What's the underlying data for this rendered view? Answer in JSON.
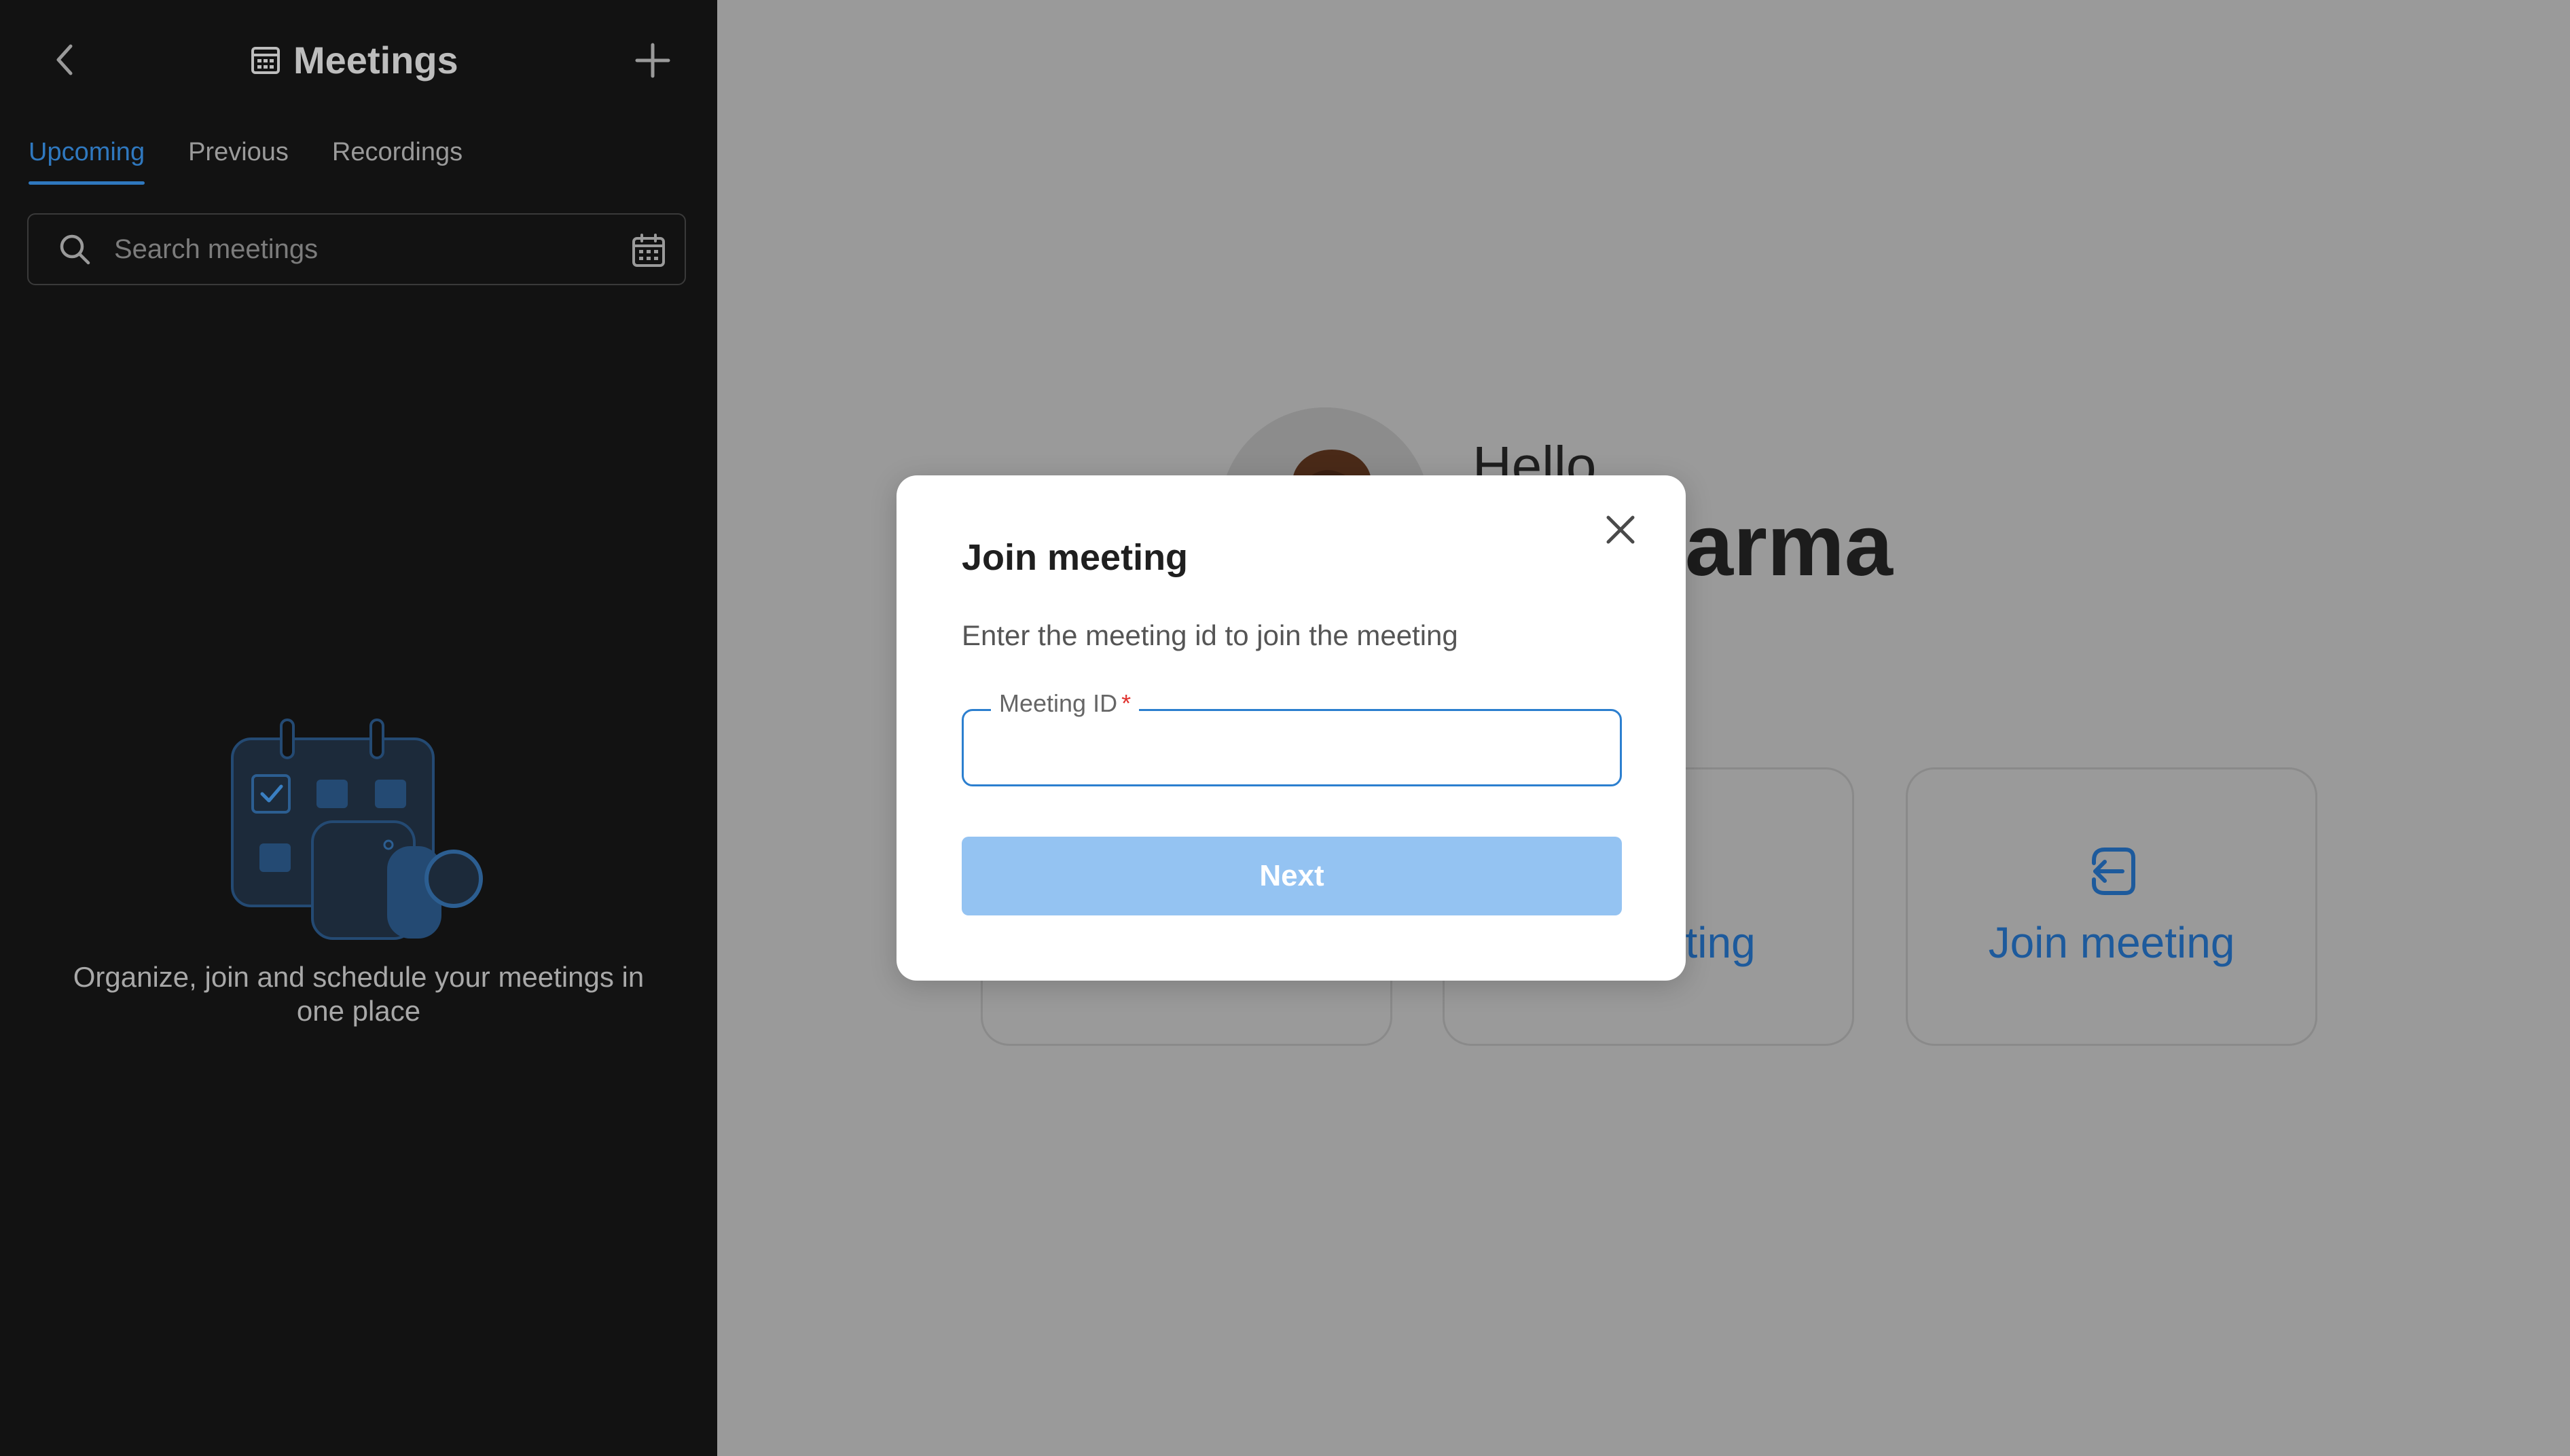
{
  "sidebar": {
    "back_icon": "chevron-left-icon",
    "title": "Meetings",
    "title_icon": "calendar-icon",
    "add_icon": "plus-icon",
    "tabs": [
      {
        "label": "Upcoming",
        "active": true
      },
      {
        "label": "Previous",
        "active": false
      },
      {
        "label": "Recordings",
        "active": false
      }
    ],
    "search": {
      "placeholder": "Search meetings",
      "icon": "search-icon",
      "calendar_icon": "calendar-icon"
    },
    "empty_state": {
      "illustration": "calendar-camera-illustration",
      "text": "Organize, join and schedule your meetings in one place"
    }
  },
  "main": {
    "greeting": "Hello",
    "user_name": "ni Sharma",
    "cards": [
      {
        "label": "",
        "icon": ""
      },
      {
        "label": "meeting",
        "icon": ""
      },
      {
        "label": "Join meeting",
        "icon": "join-enter-icon"
      }
    ]
  },
  "modal": {
    "title": "Join meeting",
    "description": "Enter the meeting id to join the meeting",
    "field": {
      "label": "Meeting ID",
      "required_mark": "*",
      "value": ""
    },
    "next_label": "Next",
    "close_icon": "close-icon"
  },
  "colors": {
    "accent": "#2f78bf",
    "sidebar_bg": "#121212",
    "overlay_bg": "#9a9a9a",
    "next_button_disabled": "#94c3f2",
    "required": "#e0322e"
  }
}
